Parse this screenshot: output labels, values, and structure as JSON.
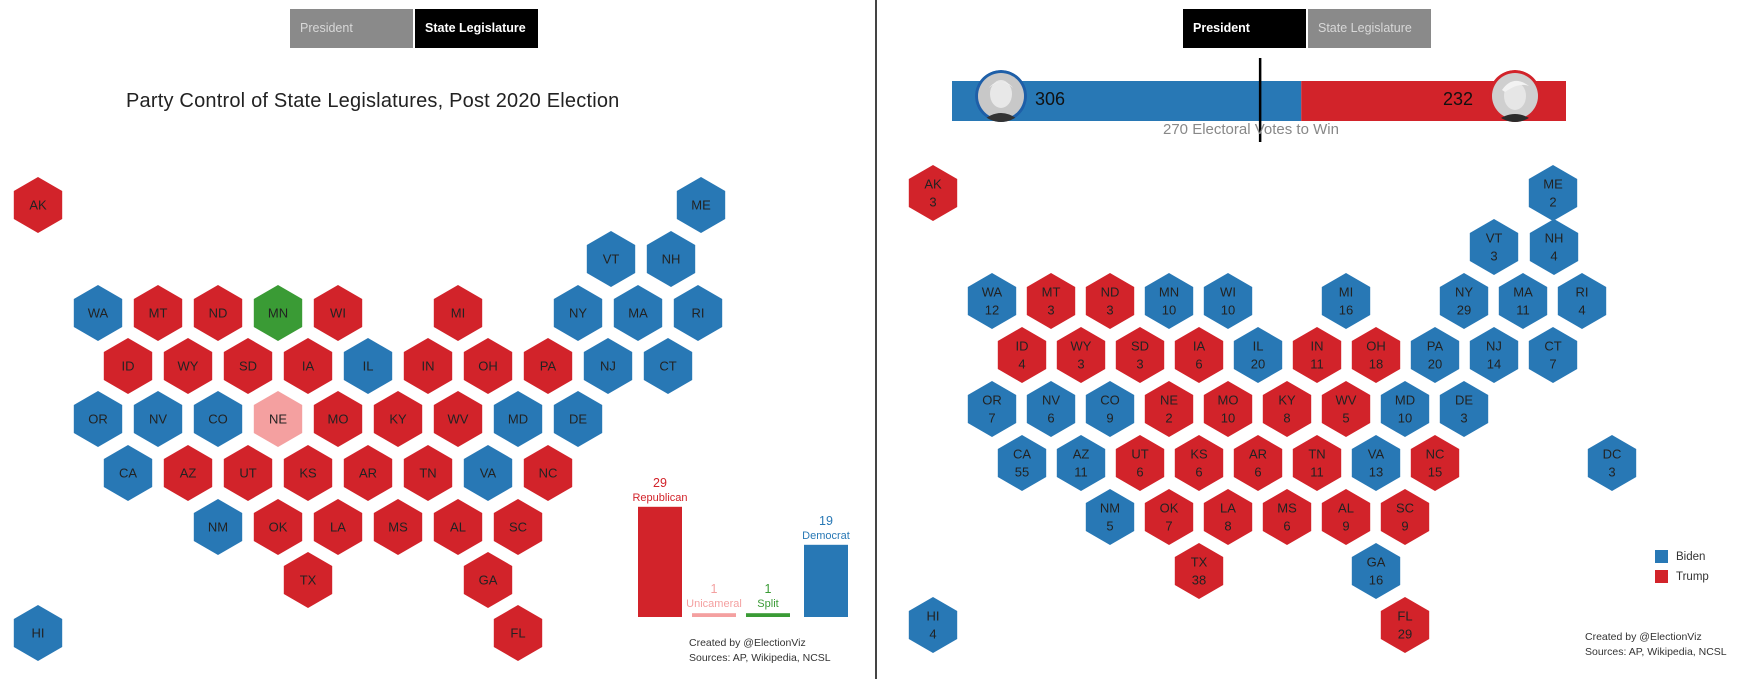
{
  "left": {
    "tabs": [
      {
        "label": "President",
        "active": false
      },
      {
        "label": "State Legislature",
        "active": true
      }
    ],
    "title": "Party Control of State Legislatures, Post 2020 Election",
    "colors": {
      "Republican": "#d2232a",
      "Democrat": "#2878b5",
      "Split": "#3a9b35",
      "Unicameral": "#f4a0a0"
    },
    "states": [
      {
        "abbr": "AK",
        "party": "Republican"
      },
      {
        "abbr": "ME",
        "party": "Democrat"
      },
      {
        "abbr": "VT",
        "party": "Democrat"
      },
      {
        "abbr": "NH",
        "party": "Democrat"
      },
      {
        "abbr": "WA",
        "party": "Democrat"
      },
      {
        "abbr": "MT",
        "party": "Republican"
      },
      {
        "abbr": "ND",
        "party": "Republican"
      },
      {
        "abbr": "MN",
        "party": "Split"
      },
      {
        "abbr": "WI",
        "party": "Republican"
      },
      {
        "abbr": "MI",
        "party": "Republican"
      },
      {
        "abbr": "NY",
        "party": "Democrat"
      },
      {
        "abbr": "MA",
        "party": "Democrat"
      },
      {
        "abbr": "RI",
        "party": "Democrat"
      },
      {
        "abbr": "ID",
        "party": "Republican"
      },
      {
        "abbr": "WY",
        "party": "Republican"
      },
      {
        "abbr": "SD",
        "party": "Republican"
      },
      {
        "abbr": "IA",
        "party": "Republican"
      },
      {
        "abbr": "IL",
        "party": "Democrat"
      },
      {
        "abbr": "IN",
        "party": "Republican"
      },
      {
        "abbr": "OH",
        "party": "Republican"
      },
      {
        "abbr": "PA",
        "party": "Republican"
      },
      {
        "abbr": "NJ",
        "party": "Democrat"
      },
      {
        "abbr": "CT",
        "party": "Democrat"
      },
      {
        "abbr": "OR",
        "party": "Democrat"
      },
      {
        "abbr": "NV",
        "party": "Democrat"
      },
      {
        "abbr": "CO",
        "party": "Democrat"
      },
      {
        "abbr": "NE",
        "party": "Unicameral"
      },
      {
        "abbr": "MO",
        "party": "Republican"
      },
      {
        "abbr": "KY",
        "party": "Republican"
      },
      {
        "abbr": "WV",
        "party": "Republican"
      },
      {
        "abbr": "MD",
        "party": "Democrat"
      },
      {
        "abbr": "DE",
        "party": "Democrat"
      },
      {
        "abbr": "CA",
        "party": "Democrat"
      },
      {
        "abbr": "AZ",
        "party": "Republican"
      },
      {
        "abbr": "UT",
        "party": "Republican"
      },
      {
        "abbr": "KS",
        "party": "Republican"
      },
      {
        "abbr": "AR",
        "party": "Republican"
      },
      {
        "abbr": "TN",
        "party": "Republican"
      },
      {
        "abbr": "VA",
        "party": "Democrat"
      },
      {
        "abbr": "NC",
        "party": "Republican"
      },
      {
        "abbr": "NM",
        "party": "Democrat"
      },
      {
        "abbr": "OK",
        "party": "Republican"
      },
      {
        "abbr": "LA",
        "party": "Republican"
      },
      {
        "abbr": "MS",
        "party": "Republican"
      },
      {
        "abbr": "AL",
        "party": "Republican"
      },
      {
        "abbr": "SC",
        "party": "Republican"
      },
      {
        "abbr": "TX",
        "party": "Republican"
      },
      {
        "abbr": "GA",
        "party": "Republican"
      },
      {
        "abbr": "FL",
        "party": "Republican"
      },
      {
        "abbr": "HI",
        "party": "Democrat"
      }
    ],
    "chart_data": {
      "type": "bar",
      "categories": [
        "Republican",
        "Unicameral",
        "Split",
        "Democrat"
      ],
      "values": [
        29,
        1,
        1,
        19
      ]
    },
    "credit": [
      "Created by @ElectionViz",
      "Sources: AP, Wikipedia, NCSL"
    ]
  },
  "right": {
    "tabs": [
      {
        "label": "President",
        "active": true
      },
      {
        "label": "State Legislature",
        "active": false
      }
    ],
    "biden_ev": 306,
    "trump_ev": 232,
    "total_ev": 538,
    "threshold_label": "270 Electoral Votes to Win",
    "colors": {
      "Biden": "#2878b5",
      "Trump": "#d2232a"
    },
    "legend": [
      "Biden",
      "Trump"
    ],
    "states": [
      {
        "abbr": "AK",
        "ev": 3,
        "winner": "Trump"
      },
      {
        "abbr": "ME",
        "ev": 2,
        "winner": "Biden"
      },
      {
        "abbr": "VT",
        "ev": 3,
        "winner": "Biden"
      },
      {
        "abbr": "NH",
        "ev": 4,
        "winner": "Biden"
      },
      {
        "abbr": "WA",
        "ev": 12,
        "winner": "Biden"
      },
      {
        "abbr": "MT",
        "ev": 3,
        "winner": "Trump"
      },
      {
        "abbr": "ND",
        "ev": 3,
        "winner": "Trump"
      },
      {
        "abbr": "MN",
        "ev": 10,
        "winner": "Biden"
      },
      {
        "abbr": "WI",
        "ev": 10,
        "winner": "Biden"
      },
      {
        "abbr": "MI",
        "ev": 16,
        "winner": "Biden"
      },
      {
        "abbr": "NY",
        "ev": 29,
        "winner": "Biden"
      },
      {
        "abbr": "MA",
        "ev": 11,
        "winner": "Biden"
      },
      {
        "abbr": "RI",
        "ev": 4,
        "winner": "Biden"
      },
      {
        "abbr": "ID",
        "ev": 4,
        "winner": "Trump"
      },
      {
        "abbr": "WY",
        "ev": 3,
        "winner": "Trump"
      },
      {
        "abbr": "SD",
        "ev": 3,
        "winner": "Trump"
      },
      {
        "abbr": "IA",
        "ev": 6,
        "winner": "Trump"
      },
      {
        "abbr": "IL",
        "ev": 20,
        "winner": "Biden"
      },
      {
        "abbr": "IN",
        "ev": 11,
        "winner": "Trump"
      },
      {
        "abbr": "OH",
        "ev": 18,
        "winner": "Trump"
      },
      {
        "abbr": "PA",
        "ev": 20,
        "winner": "Biden"
      },
      {
        "abbr": "NJ",
        "ev": 14,
        "winner": "Biden"
      },
      {
        "abbr": "CT",
        "ev": 7,
        "winner": "Biden"
      },
      {
        "abbr": "OR",
        "ev": 7,
        "winner": "Biden"
      },
      {
        "abbr": "NV",
        "ev": 6,
        "winner": "Biden"
      },
      {
        "abbr": "CO",
        "ev": 9,
        "winner": "Biden"
      },
      {
        "abbr": "NE",
        "ev": 2,
        "winner": "Trump"
      },
      {
        "abbr": "MO",
        "ev": 10,
        "winner": "Trump"
      },
      {
        "abbr": "KY",
        "ev": 8,
        "winner": "Trump"
      },
      {
        "abbr": "WV",
        "ev": 5,
        "winner": "Trump"
      },
      {
        "abbr": "MD",
        "ev": 10,
        "winner": "Biden"
      },
      {
        "abbr": "DE",
        "ev": 3,
        "winner": "Biden"
      },
      {
        "abbr": "CA",
        "ev": 55,
        "winner": "Biden"
      },
      {
        "abbr": "AZ",
        "ev": 11,
        "winner": "Biden"
      },
      {
        "abbr": "UT",
        "ev": 6,
        "winner": "Trump"
      },
      {
        "abbr": "KS",
        "ev": 6,
        "winner": "Trump"
      },
      {
        "abbr": "AR",
        "ev": 6,
        "winner": "Trump"
      },
      {
        "abbr": "TN",
        "ev": 11,
        "winner": "Trump"
      },
      {
        "abbr": "VA",
        "ev": 13,
        "winner": "Biden"
      },
      {
        "abbr": "NC",
        "ev": 15,
        "winner": "Trump"
      },
      {
        "abbr": "DC",
        "ev": 3,
        "winner": "Biden"
      },
      {
        "abbr": "NM",
        "ev": 5,
        "winner": "Biden"
      },
      {
        "abbr": "OK",
        "ev": 7,
        "winner": "Trump"
      },
      {
        "abbr": "LA",
        "ev": 8,
        "winner": "Trump"
      },
      {
        "abbr": "MS",
        "ev": 6,
        "winner": "Trump"
      },
      {
        "abbr": "AL",
        "ev": 9,
        "winner": "Trump"
      },
      {
        "abbr": "SC",
        "ev": 9,
        "winner": "Trump"
      },
      {
        "abbr": "TX",
        "ev": 38,
        "winner": "Trump"
      },
      {
        "abbr": "GA",
        "ev": 16,
        "winner": "Biden"
      },
      {
        "abbr": "HI",
        "ev": 4,
        "winner": "Biden"
      },
      {
        "abbr": "FL",
        "ev": 29,
        "winner": "Trump"
      }
    ],
    "credit": [
      "Created by @ElectionViz",
      "Sources: AP, Wikipedia, NCSL"
    ]
  }
}
